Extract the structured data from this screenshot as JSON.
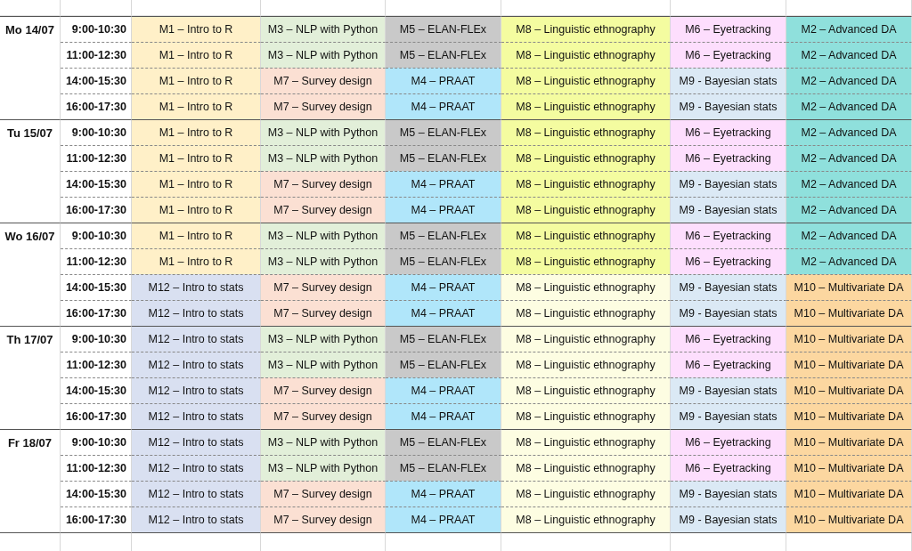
{
  "days": [
    {
      "label": "Mo 14/07",
      "slots": [
        {
          "time": "9:00-10:30",
          "cells": [
            {
              "label": "M1 – Intro to R",
              "color": "#fff0c8"
            },
            {
              "label": "M3 – NLP with Python",
              "color": "#e2efd9"
            },
            {
              "label": "M5 – ELAN-FLEx",
              "color": "#c9c9c9"
            },
            {
              "label": "M8 – Linguistic ethnography",
              "color": "#f4fca0"
            },
            {
              "label": "M6 – Eyetracking",
              "color": "#fddefd"
            },
            {
              "label": "M2 – Advanced DA",
              "color": "#8fe0dc"
            }
          ]
        },
        {
          "time": "11:00-12:30",
          "cells": [
            {
              "label": "M1 – Intro to R",
              "color": "#fff0c8"
            },
            {
              "label": "M3 – NLP with Python",
              "color": "#e2efd9"
            },
            {
              "label": "M5 – ELAN-FLEx",
              "color": "#c9c9c9"
            },
            {
              "label": "M8 – Linguistic ethnography",
              "color": "#f4fca0"
            },
            {
              "label": "M6 – Eyetracking",
              "color": "#fddefd"
            },
            {
              "label": "M2 – Advanced DA",
              "color": "#8fe0dc"
            }
          ]
        },
        {
          "time": "14:00-15:30",
          "cells": [
            {
              "label": "M1 – Intro to R",
              "color": "#fff0c8"
            },
            {
              "label": "M7 – Survey design",
              "color": "#fbe0d3"
            },
            {
              "label": "M4 – PRAAT",
              "color": "#b0e6fa"
            },
            {
              "label": "M8 – Linguistic ethnography",
              "color": "#f4fca0"
            },
            {
              "label": "M9 - Bayesian stats",
              "color": "#dbe9f5"
            },
            {
              "label": "M2 – Advanced DA",
              "color": "#8fe0dc"
            }
          ]
        },
        {
          "time": "16:00-17:30",
          "cells": [
            {
              "label": "M1 – Intro to R",
              "color": "#fff0c8"
            },
            {
              "label": "M7 – Survey design",
              "color": "#fbe0d3"
            },
            {
              "label": "M4 – PRAAT",
              "color": "#b0e6fa"
            },
            {
              "label": "M8 – Linguistic ethnography",
              "color": "#f4fca0"
            },
            {
              "label": "M9 - Bayesian stats",
              "color": "#dbe9f5"
            },
            {
              "label": "M2 – Advanced DA",
              "color": "#8fe0dc"
            }
          ]
        }
      ]
    },
    {
      "label": "Tu 15/07",
      "slots": [
        {
          "time": "9:00-10:30",
          "cells": [
            {
              "label": "M1 – Intro to R",
              "color": "#fff0c8"
            },
            {
              "label": "M3 – NLP with Python",
              "color": "#e2efd9"
            },
            {
              "label": "M5 – ELAN-FLEx",
              "color": "#c9c9c9"
            },
            {
              "label": "M8 – Linguistic ethnography",
              "color": "#f4fca0"
            },
            {
              "label": "M6 – Eyetracking",
              "color": "#fddefd"
            },
            {
              "label": "M2 – Advanced DA",
              "color": "#8fe0dc"
            }
          ]
        },
        {
          "time": "11:00-12:30",
          "cells": [
            {
              "label": "M1 – Intro to R",
              "color": "#fff0c8"
            },
            {
              "label": "M3 – NLP with Python",
              "color": "#e2efd9"
            },
            {
              "label": "M5 – ELAN-FLEx",
              "color": "#c9c9c9"
            },
            {
              "label": "M8 – Linguistic ethnography",
              "color": "#f4fca0"
            },
            {
              "label": "M6 – Eyetracking",
              "color": "#fddefd"
            },
            {
              "label": "M2 – Advanced DA",
              "color": "#8fe0dc"
            }
          ]
        },
        {
          "time": "14:00-15:30",
          "cells": [
            {
              "label": "M1 – Intro to R",
              "color": "#fff0c8"
            },
            {
              "label": "M7 – Survey design",
              "color": "#fbe0d3"
            },
            {
              "label": "M4 – PRAAT",
              "color": "#b0e6fa"
            },
            {
              "label": "M8 – Linguistic ethnography",
              "color": "#f4fca0"
            },
            {
              "label": "M9 - Bayesian stats",
              "color": "#dbe9f5"
            },
            {
              "label": "M2 – Advanced DA",
              "color": "#8fe0dc"
            }
          ]
        },
        {
          "time": "16:00-17:30",
          "cells": [
            {
              "label": "M1 – Intro to R",
              "color": "#fff0c8"
            },
            {
              "label": "M7 – Survey design",
              "color": "#fbe0d3"
            },
            {
              "label": "M4 – PRAAT",
              "color": "#b0e6fa"
            },
            {
              "label": "M8 – Linguistic ethnography",
              "color": "#f4fca0"
            },
            {
              "label": "M9 - Bayesian stats",
              "color": "#dbe9f5"
            },
            {
              "label": "M2 – Advanced DA",
              "color": "#8fe0dc"
            }
          ]
        }
      ]
    },
    {
      "label": "Wo 16/07",
      "slots": [
        {
          "time": "9:00-10:30",
          "cells": [
            {
              "label": "M1 – Intro to R",
              "color": "#fff0c8"
            },
            {
              "label": "M3 – NLP with Python",
              "color": "#e2efd9"
            },
            {
              "label": "M5 – ELAN-FLEx",
              "color": "#c9c9c9"
            },
            {
              "label": "M8 – Linguistic ethnography",
              "color": "#f4fca0"
            },
            {
              "label": "M6 – Eyetracking",
              "color": "#fddefd"
            },
            {
              "label": "M2 – Advanced DA",
              "color": "#8fe0dc"
            }
          ]
        },
        {
          "time": "11:00-12:30",
          "cells": [
            {
              "label": "M1 – Intro to R",
              "color": "#fff0c8"
            },
            {
              "label": "M3 – NLP with Python",
              "color": "#e2efd9"
            },
            {
              "label": "M5 – ELAN-FLEx",
              "color": "#c9c9c9"
            },
            {
              "label": "M8 – Linguistic ethnography",
              "color": "#f4fca0"
            },
            {
              "label": "M6 – Eyetracking",
              "color": "#fddefd"
            },
            {
              "label": "M2 – Advanced DA",
              "color": "#8fe0dc"
            }
          ]
        },
        {
          "time": "14:00-15:30",
          "cells": [
            {
              "label": "M12 – Intro to stats",
              "color": "#d9e0f1"
            },
            {
              "label": "M7 – Survey design",
              "color": "#fbe0d3"
            },
            {
              "label": "M4 – PRAAT",
              "color": "#b0e6fa"
            },
            {
              "label": "M8 – Linguistic ethnography",
              "color": "#fdfde2"
            },
            {
              "label": "M9 - Bayesian stats",
              "color": "#dbe9f5"
            },
            {
              "label": "M10 – Multivariate DA",
              "color": "#fcd7a0"
            }
          ]
        },
        {
          "time": "16:00-17:30",
          "cells": [
            {
              "label": "M12 – Intro to stats",
              "color": "#d9e0f1"
            },
            {
              "label": "M7 – Survey design",
              "color": "#fbe0d3"
            },
            {
              "label": "M4 – PRAAT",
              "color": "#b0e6fa"
            },
            {
              "label": "M8 – Linguistic ethnography",
              "color": "#fdfde2"
            },
            {
              "label": "M9 - Bayesian stats",
              "color": "#dbe9f5"
            },
            {
              "label": "M10 – Multivariate DA",
              "color": "#fcd7a0"
            }
          ]
        }
      ]
    },
    {
      "label": "Th 17/07",
      "slots": [
        {
          "time": "9:00-10:30",
          "cells": [
            {
              "label": "M12 – Intro to stats",
              "color": "#d9e0f1"
            },
            {
              "label": "M3 – NLP with Python",
              "color": "#e2efd9"
            },
            {
              "label": "M5 – ELAN-FLEx",
              "color": "#c9c9c9"
            },
            {
              "label": "M8 – Linguistic ethnography",
              "color": "#fdfde2"
            },
            {
              "label": "M6 – Eyetracking",
              "color": "#fddefd"
            },
            {
              "label": "M10 – Multivariate DA",
              "color": "#fcd7a0"
            }
          ]
        },
        {
          "time": "11:00-12:30",
          "cells": [
            {
              "label": "M12 – Intro to stats",
              "color": "#d9e0f1"
            },
            {
              "label": "M3 – NLP with Python",
              "color": "#e2efd9"
            },
            {
              "label": "M5 – ELAN-FLEx",
              "color": "#c9c9c9"
            },
            {
              "label": "M8 – Linguistic ethnography",
              "color": "#fdfde2"
            },
            {
              "label": "M6 – Eyetracking",
              "color": "#fddefd"
            },
            {
              "label": "M10 – Multivariate DA",
              "color": "#fcd7a0"
            }
          ]
        },
        {
          "time": "14:00-15:30",
          "cells": [
            {
              "label": "M12 – Intro to stats",
              "color": "#d9e0f1"
            },
            {
              "label": "M7 – Survey design",
              "color": "#fbe0d3"
            },
            {
              "label": "M4 – PRAAT",
              "color": "#b0e6fa"
            },
            {
              "label": "M8 – Linguistic ethnography",
              "color": "#fdfde2"
            },
            {
              "label": "M9 - Bayesian stats",
              "color": "#dbe9f5"
            },
            {
              "label": "M10 – Multivariate DA",
              "color": "#fcd7a0"
            }
          ]
        },
        {
          "time": "16:00-17:30",
          "cells": [
            {
              "label": "M12 – Intro to stats",
              "color": "#d9e0f1"
            },
            {
              "label": "M7 – Survey design",
              "color": "#fbe0d3"
            },
            {
              "label": "M4 – PRAAT",
              "color": "#b0e6fa"
            },
            {
              "label": "M8 – Linguistic ethnography",
              "color": "#fdfde2"
            },
            {
              "label": "M9 - Bayesian stats",
              "color": "#dbe9f5"
            },
            {
              "label": "M10 – Multivariate DA",
              "color": "#fcd7a0"
            }
          ]
        }
      ]
    },
    {
      "label": "Fr 18/07",
      "slots": [
        {
          "time": "9:00-10:30",
          "cells": [
            {
              "label": "M12 – Intro to stats",
              "color": "#d9e0f1"
            },
            {
              "label": "M3 – NLP with Python",
              "color": "#e2efd9"
            },
            {
              "label": "M5 – ELAN-FLEx",
              "color": "#c9c9c9"
            },
            {
              "label": "M8 – Linguistic ethnography",
              "color": "#fdfde2"
            },
            {
              "label": "M6 – Eyetracking",
              "color": "#fddefd"
            },
            {
              "label": "M10 – Multivariate DA",
              "color": "#fcd7a0"
            }
          ]
        },
        {
          "time": "11:00-12:30",
          "cells": [
            {
              "label": "M12 – Intro to stats",
              "color": "#d9e0f1"
            },
            {
              "label": "M3 – NLP with Python",
              "color": "#e2efd9"
            },
            {
              "label": "M5 – ELAN-FLEx",
              "color": "#c9c9c9"
            },
            {
              "label": "M8 – Linguistic ethnography",
              "color": "#fdfde2"
            },
            {
              "label": "M6 – Eyetracking",
              "color": "#fddefd"
            },
            {
              "label": "M10 – Multivariate DA",
              "color": "#fcd7a0"
            }
          ]
        },
        {
          "time": "14:00-15:30",
          "cells": [
            {
              "label": "M12 – Intro to stats",
              "color": "#d9e0f1"
            },
            {
              "label": "M7 – Survey design",
              "color": "#fbe0d3"
            },
            {
              "label": "M4 – PRAAT",
              "color": "#b0e6fa"
            },
            {
              "label": "M8 – Linguistic ethnography",
              "color": "#fdfde2"
            },
            {
              "label": "M9 - Bayesian stats",
              "color": "#dbe9f5"
            },
            {
              "label": "M10 – Multivariate DA",
              "color": "#fcd7a0"
            }
          ]
        },
        {
          "time": "16:00-17:30",
          "cells": [
            {
              "label": "M12 – Intro to stats",
              "color": "#d9e0f1"
            },
            {
              "label": "M7 – Survey design",
              "color": "#fbe0d3"
            },
            {
              "label": "M4 – PRAAT",
              "color": "#b0e6fa"
            },
            {
              "label": "M8 – Linguistic ethnography",
              "color": "#fdfde2"
            },
            {
              "label": "M9 - Bayesian stats",
              "color": "#dbe9f5"
            },
            {
              "label": "M10 – Multivariate DA",
              "color": "#fcd7a0"
            }
          ]
        }
      ]
    }
  ]
}
